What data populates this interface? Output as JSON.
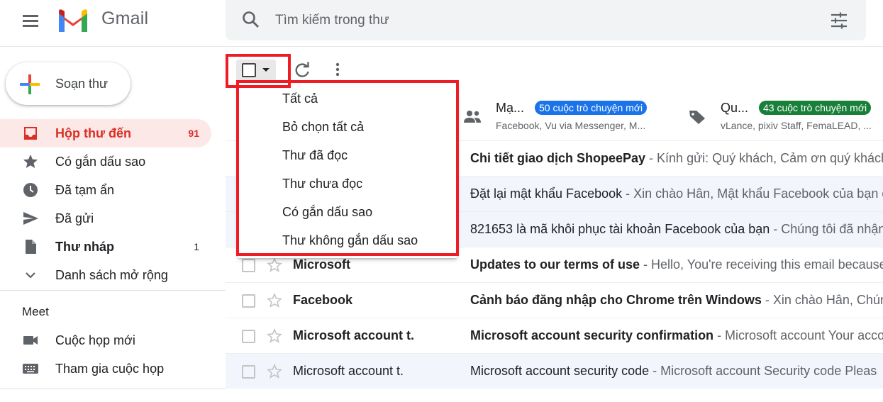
{
  "header": {
    "app_name": "Gmail",
    "search_placeholder": "Tìm kiếm trong thư"
  },
  "compose": {
    "label": "Soạn thư"
  },
  "sidebar": {
    "items": [
      {
        "label": "Hộp thư đến",
        "count": "91",
        "icon": "inbox-icon"
      },
      {
        "label": "Có gắn dấu sao",
        "count": "",
        "icon": "star-icon"
      },
      {
        "label": "Đã tạm ẩn",
        "count": "",
        "icon": "clock-icon"
      },
      {
        "label": "Đã gửi",
        "count": "",
        "icon": "send-icon"
      },
      {
        "label": "Thư nháp",
        "count": "1",
        "icon": "draft-icon"
      },
      {
        "label": "Danh sách mở rộng",
        "count": "",
        "icon": "chevron-down-icon"
      }
    ],
    "meet_title": "Meet",
    "meet_items": [
      {
        "label": "Cuộc họp mới",
        "icon": "video-icon"
      },
      {
        "label": "Tham gia cuộc họp",
        "icon": "keyboard-icon"
      }
    ]
  },
  "tabs": [
    {
      "name": "Mạ...",
      "badge": "50 cuộc trò chuyện mới",
      "badge_color": "#1a73e8",
      "senders": "Facebook, Vu via Messenger, M...",
      "icon": "people-icon"
    },
    {
      "name": "Qu...",
      "badge": "43 cuộc trò chuyện mới",
      "badge_color": "#188038",
      "senders": "vLance, pixiv Staff, FemaLEAD, ...",
      "icon": "tag-icon"
    }
  ],
  "emails": [
    {
      "sender": "",
      "subject": "Chi tiết giao dịch ShopeePay",
      "snippet": " - Kính gửi: Quý khách, Cảm ơn quý khách đã",
      "unread": true
    },
    {
      "sender": "",
      "subject": "Đặt lại mật khẩu Facebook",
      "snippet": " - Xin chào Hân, Mật khẩu Facebook của bạn đ",
      "unread": false
    },
    {
      "sender": "",
      "subject": "821653 là mã khôi phục tài khoản Facebook của bạn",
      "snippet": " - Chúng tôi đã nhận",
      "unread": false
    },
    {
      "sender": "Microsoft",
      "subject": "Updates to our terms of use",
      "snippet": " - Hello, You're receiving this email because w",
      "unread": true
    },
    {
      "sender": "Facebook",
      "subject": "Cảnh báo đăng nhập cho Chrome trên Windows",
      "snippet": " - Xin chào Hân, Chúng tô",
      "unread": true
    },
    {
      "sender": "Microsoft account t.",
      "subject": "Microsoft account security confirmation",
      "snippet": " - Microsoft account Your accou",
      "unread": true
    },
    {
      "sender": "Microsoft account t.",
      "subject": "Microsoft account security code",
      "snippet": " - Microsoft account Security code Pleas",
      "unread": false
    }
  ],
  "select_menu": {
    "items": [
      "Tất cả",
      "Bỏ chọn tất cả",
      "Thư đã đọc",
      "Thư chưa đọc",
      "Có gắn dấu sao",
      "Thư không gắn dấu sao"
    ]
  },
  "colors": {
    "highlight": "#ee1c25",
    "active_nav_bg": "#fce8e6",
    "active_nav_text": "#d93025"
  }
}
